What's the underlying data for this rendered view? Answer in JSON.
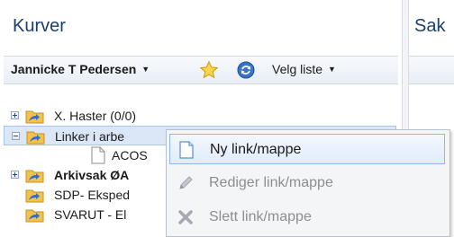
{
  "left_panel": {
    "title": "Kurver"
  },
  "toolbar": {
    "user": "Jannicke T Pedersen",
    "list_selector": "Velg liste"
  },
  "tree": {
    "nodes": [
      {
        "label": "X. Haster (0/0)",
        "expanded": false,
        "bold": false,
        "icon": "folder-link-icon"
      },
      {
        "label": "Linker i arbe",
        "expanded": true,
        "bold": false,
        "icon": "folder-link-icon",
        "selected": true
      },
      {
        "label": "ACOS",
        "child": true,
        "icon": "document-icon"
      },
      {
        "label": "Arkivsak ØA",
        "expanded": false,
        "bold": true,
        "icon": "folder-link-icon"
      },
      {
        "label": "SDP- Eksped",
        "bold": false,
        "icon": "folder-link-icon"
      },
      {
        "label": "SVARUT - El",
        "bold": false,
        "icon": "folder-link-icon"
      }
    ]
  },
  "right_panel": {
    "title": "Sak"
  },
  "context_menu": {
    "items": [
      {
        "label": "Ny link/mappe",
        "enabled": true,
        "icon": "new-document-icon"
      },
      {
        "label": "Rediger link/mappe",
        "enabled": false,
        "icon": "pencil-icon"
      },
      {
        "label": "Slett link/mappe",
        "enabled": false,
        "icon": "delete-x-icon"
      }
    ]
  },
  "colors": {
    "title": "#1b3f6b",
    "selection": "#dbe7f6",
    "menu_highlight_border": "#8fb8e6",
    "folder": "#f2c14e",
    "link_arrow": "#2f6fd0"
  }
}
